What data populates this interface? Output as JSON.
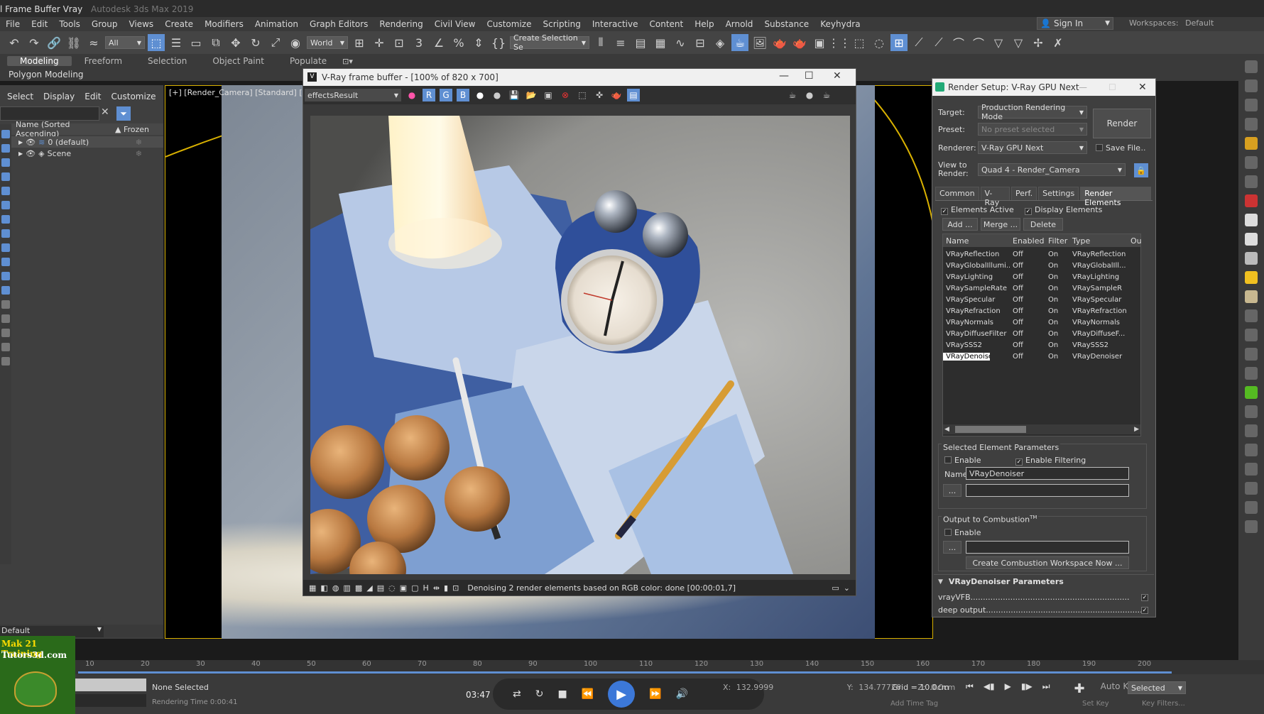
{
  "app": {
    "title": "l Frame Buffer Vray",
    "sub_title": "Autodesk 3ds Max 2019"
  },
  "menu": [
    "File",
    "Edit",
    "Tools",
    "Group",
    "Views",
    "Create",
    "Modifiers",
    "Animation",
    "Graph Editors",
    "Rendering",
    "Civil View",
    "Customize",
    "Scripting",
    "Interactive",
    "Content",
    "Help",
    "Arnold",
    "Substance",
    "Keyhydra"
  ],
  "signin": {
    "label": "Sign In"
  },
  "workspaces": {
    "label": "Workspaces:",
    "value": "Default"
  },
  "toolbar": {
    "filter_all": "All",
    "coord": "World",
    "selection_set": "Create Selection Se"
  },
  "ribbon": {
    "tabs": [
      "Modeling",
      "Freeform",
      "Selection",
      "Object Paint",
      "Populate"
    ],
    "sub": "Polygon Modeling"
  },
  "scene": {
    "menu": [
      "Select",
      "Display",
      "Edit",
      "Customize"
    ],
    "header_name": "Name (Sorted Ascending)",
    "header_frozen": "▲ Frozen",
    "rows": [
      "0 (default)",
      "Scene"
    ],
    "layer": "Default"
  },
  "viewport": {
    "label": "[+] [Render_Camera] [Standard] [Default"
  },
  "vfb": {
    "title": "V-Ray frame buffer - [100% of 820 x 700]",
    "channel": "effectsResult",
    "status": "Denoising 2 render elements based on RGB color: done [00:00:01,7]"
  },
  "render_setup": {
    "title": "Render Setup: V-Ray GPU Next",
    "target_label": "Target:",
    "target": "Production Rendering Mode",
    "preset_label": "Preset:",
    "preset": "No preset selected",
    "renderer_label": "Renderer:",
    "renderer": "V-Ray GPU Next",
    "save_file": "Save File",
    "view_label": "View to Render:",
    "view": "Quad 4 - Render_Camera",
    "render_btn": "Render",
    "tabs": [
      "Common",
      "V-Ray",
      "Perf.",
      "Settings",
      "Render Elements"
    ],
    "elements_active": "Elements Active",
    "display_elements": "Display Elements",
    "add": "Add ...",
    "merge": "Merge ...",
    "delete": "Delete",
    "columns": [
      "Name",
      "Enabled",
      "Filter",
      "Type",
      "Ou"
    ],
    "elements": [
      {
        "name": "VRayReflection",
        "enabled": "Off",
        "filter": "On",
        "type": "VRayReflection"
      },
      {
        "name": "VRayGlobalIllumi...",
        "enabled": "Off",
        "filter": "On",
        "type": "VRayGlobalIll..."
      },
      {
        "name": "VRayLighting",
        "enabled": "Off",
        "filter": "On",
        "type": "VRayLighting"
      },
      {
        "name": "VRaySampleRate",
        "enabled": "Off",
        "filter": "On",
        "type": "VRaySampleR"
      },
      {
        "name": "VRaySpecular",
        "enabled": "Off",
        "filter": "On",
        "type": "VRaySpecular"
      },
      {
        "name": "VRayRefraction",
        "enabled": "Off",
        "filter": "On",
        "type": "VRayRefraction"
      },
      {
        "name": "VRayNormals",
        "enabled": "Off",
        "filter": "On",
        "type": "VRayNormals"
      },
      {
        "name": "VRayDiffuseFilter",
        "enabled": "Off",
        "filter": "On",
        "type": "VRayDiffuseF..."
      },
      {
        "name": "VRaySSS2",
        "enabled": "Off",
        "filter": "On",
        "type": "VRaySSS2"
      },
      {
        "name": "VRayDenoiser",
        "enabled": "Off",
        "filter": "On",
        "type": "VRayDenoiser"
      }
    ],
    "sel_params": "Selected Element Parameters",
    "enable": "Enable",
    "enable_filtering": "Enable Filtering",
    "name_label": "Name:",
    "name_value": "VRayDenoiser",
    "dots": "...",
    "combustion": "Output to Combustion",
    "combustion_tm": "TM",
    "combustion_btn": "Create Combustion Workspace Now ...",
    "denoiser_params": "VRayDenoiser Parameters",
    "vrayvfb": "vrayVFB................................................................",
    "deep_output": "deep output................................................................"
  },
  "timeline": {
    "ticks": [
      "10",
      "20",
      "30",
      "40",
      "50",
      "60",
      "70",
      "80",
      "90",
      "100",
      "110",
      "120",
      "130",
      "140",
      "150",
      "160",
      "170",
      "180",
      "190",
      "200"
    ]
  },
  "status": {
    "selection": "None Selected",
    "rendering_time": "Rendering Time 0:00:41",
    "timecode": "03:47",
    "x_label": "X:",
    "x_value": "132.9999",
    "y_label": "Y:",
    "y_value": "134.77726",
    "z_label": "Z:",
    "z_value": "0.0cm",
    "grid": "Grid = 10.0cm",
    "autokey": "Auto Key",
    "selected": "Selected",
    "set_key": "Set Key",
    "key_filters": "Key Filters...",
    "add_time_tag": "Add Time Tag"
  },
  "logo": {
    "line1": "Mak 21 Training",
    "line2": "Tutors3d.com"
  },
  "colors": {
    "accent": "#5f8fd2",
    "viewport_border": "#d9b100",
    "play": "#3c78d8"
  }
}
